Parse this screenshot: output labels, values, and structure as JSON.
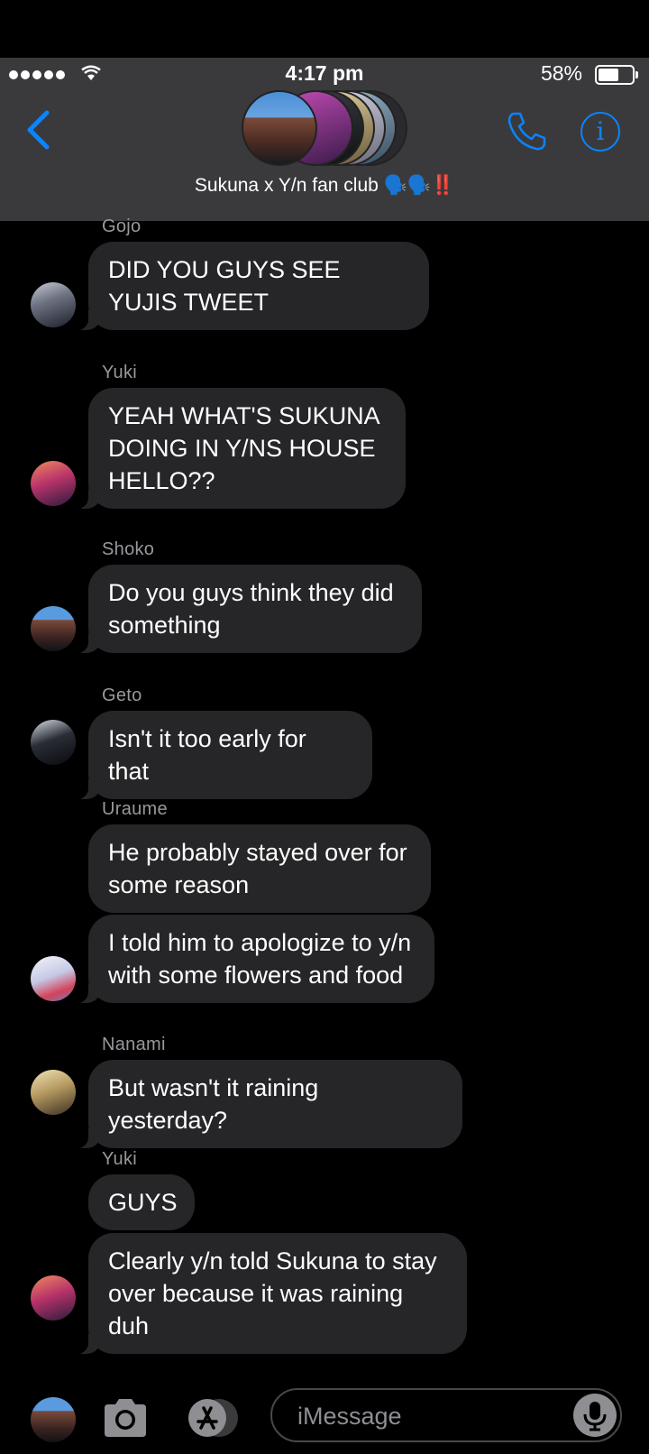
{
  "status_bar": {
    "time": "4:17 pm",
    "battery": "58%"
  },
  "header": {
    "group_name": "Sukuna x Y/n fan club 🗣️🗣️‼️"
  },
  "messages": [
    {
      "sender": "Gojo",
      "bubbles": [
        "DID YOU GUYS SEE YUJIS TWEET"
      ]
    },
    {
      "sender": "Yuki",
      "bubbles": [
        "YEAH WHAT'S SUKUNA DOING IN Y/NS HOUSE HELLO??"
      ]
    },
    {
      "sender": "Shoko",
      "bubbles": [
        "Do you guys think they did something"
      ]
    },
    {
      "sender": "Geto",
      "bubbles": [
        "Isn't it too early for that"
      ]
    },
    {
      "sender": "Uraume",
      "bubbles": [
        "He probably stayed over for some reason",
        "I told him to apologize to y/n with some flowers and food"
      ]
    },
    {
      "sender": "Nanami",
      "bubbles": [
        "But wasn't it raining yesterday?"
      ]
    },
    {
      "sender": "Yuki",
      "bubbles": [
        "GUYS",
        "Clearly y/n told Sukuna to stay over because it was raining duh"
      ]
    }
  ],
  "input": {
    "placeholder": "iMessage"
  },
  "colors": {
    "accent": "#0a84ff",
    "bubble": "#262628",
    "header": "#3a3a3c"
  }
}
